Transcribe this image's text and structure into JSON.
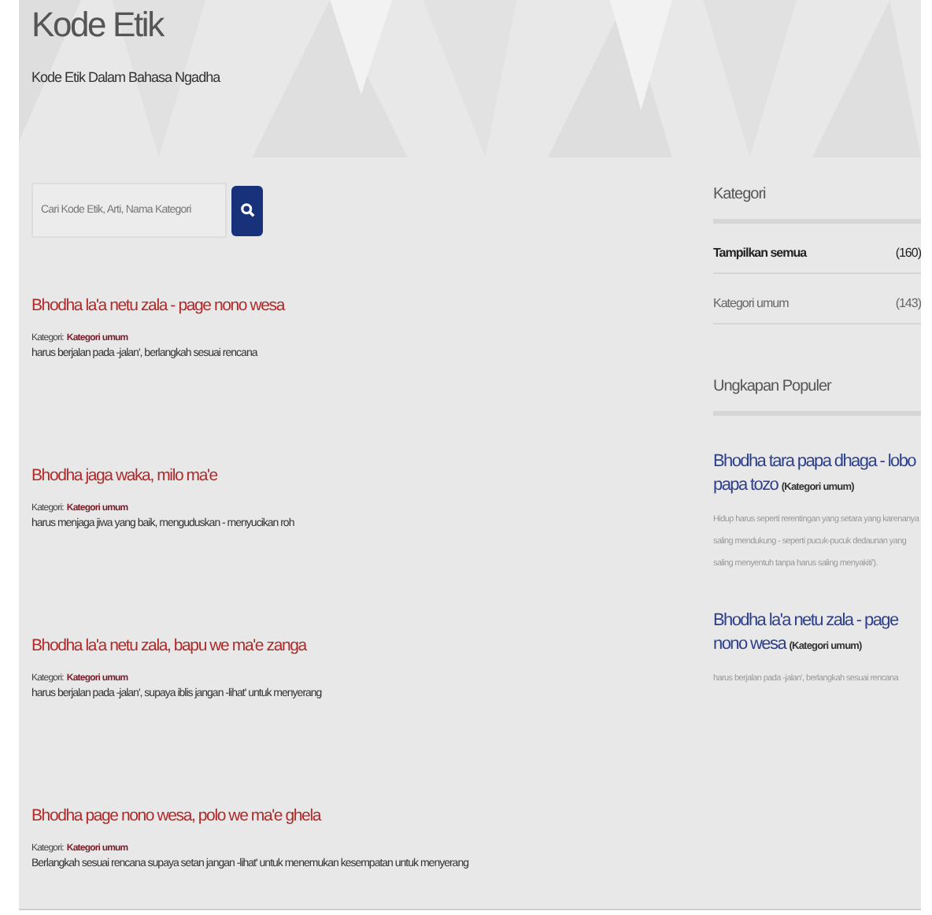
{
  "header": {
    "title": "Kode Etik",
    "subtitle": "Kode Etik Dalam Bahasa Ngadha"
  },
  "search": {
    "placeholder": "Cari Kode Etik, Arti, Nama Kategori"
  },
  "entries": [
    {
      "title": "Bhodha la'a netu zala - page nono wesa",
      "category_label": "Kategori:",
      "category": "Kategori umum",
      "meaning": "harus berjalan pada -jalan', berlangkah sesuai rencana"
    },
    {
      "title": "Bhodha jaga waka, milo ma'e",
      "category_label": "Kategori:",
      "category": "Kategori umum",
      "meaning": "harus menjaga jiwa yang baik, menguduskan - menyucikan roh"
    },
    {
      "title": "Bhodha la'a netu zala, bapu we ma'e zanga",
      "category_label": "Kategori:",
      "category": "Kategori umum",
      "meaning": "harus berjalan pada -jalan', supaya iblis jangan -lihat' untuk menyerang"
    },
    {
      "title": "Bhodha page nono wesa, polo we ma'e ghela",
      "category_label": "Kategori:",
      "category": "Kategori umum",
      "meaning": "Berlangkah sesuai rencana supaya setan jangan -lihat' untuk menemukan kesempatan untuk menyerang"
    }
  ],
  "sidebar": {
    "categories_title": "Kategori",
    "categories": [
      {
        "name": "Tampilkan semua",
        "count": "(160)",
        "selected": true
      },
      {
        "name": "Kategori umum",
        "count": "(143)",
        "selected": false
      }
    ],
    "popular_title": "Ungkapan Populer",
    "popular": [
      {
        "title": "Bhodha tara papa dhaga - lobo papa tozo",
        "category": "(Kategori umum)",
        "description": "Hidup harus seperti rerentingan yang setara yang karenanya saling mendukung - seperti pucuk-pucuk dedaunan yang saling menyentuh tanpa harus saling menyakiti')."
      },
      {
        "title": "Bhodha la'a netu zala - page nono wesa",
        "category": "(Kategori umum)",
        "description": "harus berjalan pada -jalan', berlangkah sesuai rencana"
      }
    ]
  }
}
